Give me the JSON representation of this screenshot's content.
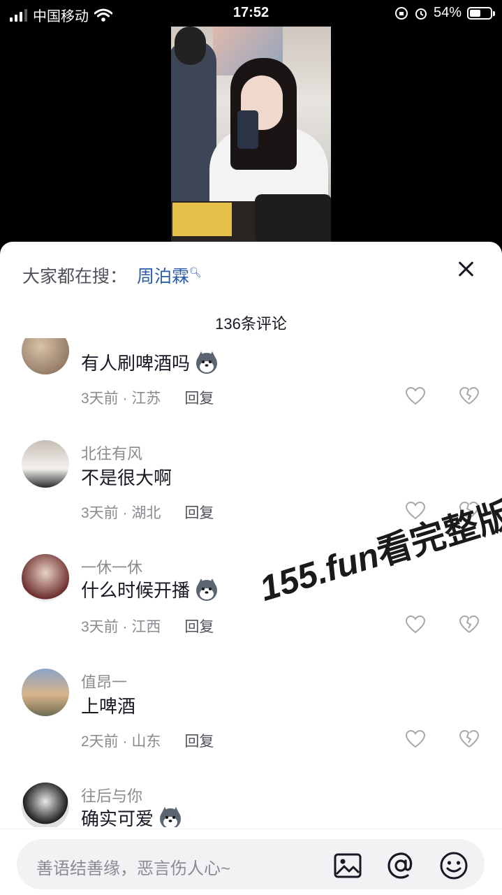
{
  "status_bar": {
    "carrier": "中国移动",
    "time": "17:52",
    "battery": "54%"
  },
  "video": {
    "description_icon": "video-frame"
  },
  "sheet": {
    "search_prefix": "大家都在搜：",
    "search_term": "周泊霖",
    "comment_count": "136条评论",
    "comments": [
      {
        "author": "",
        "text": "有人刷啤酒吗",
        "has_emoji": true,
        "time_location": "3天前 · 江苏",
        "reply": "回复"
      },
      {
        "author": "北往有风",
        "text": "不是很大啊",
        "has_emoji": false,
        "time_location": "3天前 · 湖北",
        "reply": "回复"
      },
      {
        "author": "一休一休",
        "text": "什么时候开播",
        "has_emoji": true,
        "time_location": "3天前 · 江西",
        "reply": "回复"
      },
      {
        "author": "值昂一",
        "text": "上啤酒",
        "has_emoji": false,
        "time_location": "2天前 · 山东",
        "reply": "回复"
      },
      {
        "author": "往后与你",
        "text": "确实可爱",
        "has_emoji": true,
        "time_location": "",
        "reply": ""
      }
    ],
    "watermark_site": "155.fun",
    "watermark_text": "看完整版"
  },
  "input_bar": {
    "placeholder": "善语结善缘，恶言伤人心~",
    "icons": [
      "image-icon",
      "at-icon",
      "emoji-icon"
    ]
  },
  "colors": {
    "accent_link": "#2a5caa",
    "text_primary": "#161823",
    "text_secondary": "#8a8b91"
  }
}
